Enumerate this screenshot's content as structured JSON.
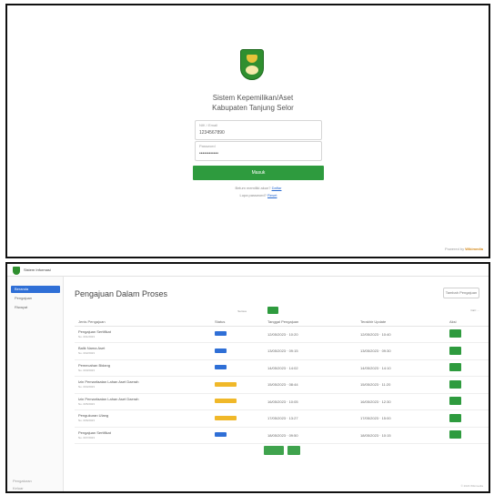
{
  "login": {
    "app_title_line1": "Sistem Kepemilikan/Aset",
    "app_title_line2": "Kabupaten Tanjung Selor",
    "username_label": "NIK / Email",
    "username_value": "1234567890",
    "password_label": "Password",
    "password_value": "••••••••••••",
    "login_button": "Masuk",
    "note_line1_text": "Belum memiliki akun?",
    "note_line1_link": "Daftar",
    "note_line2_text": "Lupa password?",
    "note_line2_link": "Reset",
    "powered_text": "Powered by",
    "powered_brand": "Wikimedia"
  },
  "dashboard": {
    "header_title": "Sistem Informasi",
    "sidebar": {
      "items": [
        {
          "label": "Beranda",
          "active": true
        },
        {
          "label": "Pengajuan",
          "active": false
        },
        {
          "label": "Riwayat",
          "active": false
        }
      ],
      "bottom_items": [
        "Pengaturan",
        "Keluar"
      ]
    },
    "page_title": "Pengajuan Dalam Proses",
    "header_button": "Tambah Pengajuan",
    "toolbar_select": "Semua",
    "toolbar_right": "Cari: ...",
    "columns": [
      "Jenis Pengajuan",
      "Status",
      "Tanggal Pengajuan",
      "Terakhir Update",
      "Aksi"
    ],
    "rows": [
      {
        "title": "Pengajuan Sertifikat",
        "sub": "No. 001/2023",
        "status": "blue",
        "date": "12/05/2023 · 10:20",
        "updated": "12/05/2023 · 10:40"
      },
      {
        "title": "Balik Nama Aset",
        "sub": "No. 002/2023",
        "status": "blue",
        "date": "13/05/2023 · 09:15",
        "updated": "13/05/2023 · 09:30"
      },
      {
        "title": "Pemecahan Bidang",
        "sub": "No. 003/2023",
        "status": "blue",
        "date": "14/05/2023 · 14:02",
        "updated": "14/05/2023 · 14:10"
      },
      {
        "title": "Izin Pemanfaatan Lahan Aset Daerah",
        "sub": "No. 004/2023",
        "status": "yellow",
        "date": "15/05/2023 · 08:44",
        "updated": "15/05/2023 · 11:20"
      },
      {
        "title": "Izin Pemanfaatan Lahan Aset Daerah",
        "sub": "No. 005/2023",
        "status": "yellow",
        "date": "16/05/2023 · 10:05",
        "updated": "16/05/2023 · 12:30"
      },
      {
        "title": "Pengukuran Ulang",
        "sub": "No. 006/2023",
        "status": "yellow",
        "date": "17/05/2023 · 13:27",
        "updated": "17/05/2023 · 15:00"
      },
      {
        "title": "Pengajuan Sertifikat",
        "sub": "No. 007/2023",
        "status": "blue",
        "date": "18/05/2023 · 09:50",
        "updated": "18/05/2023 · 10:15"
      }
    ],
    "pager": [
      "Sebelumnya",
      "1"
    ],
    "footer": "© 2023 Wikimedia"
  },
  "colors": {
    "primary_green": "#2e9b3e",
    "link_blue": "#2a6bd1",
    "status_blue": "#2f6fd6",
    "status_yellow": "#f0b829"
  }
}
